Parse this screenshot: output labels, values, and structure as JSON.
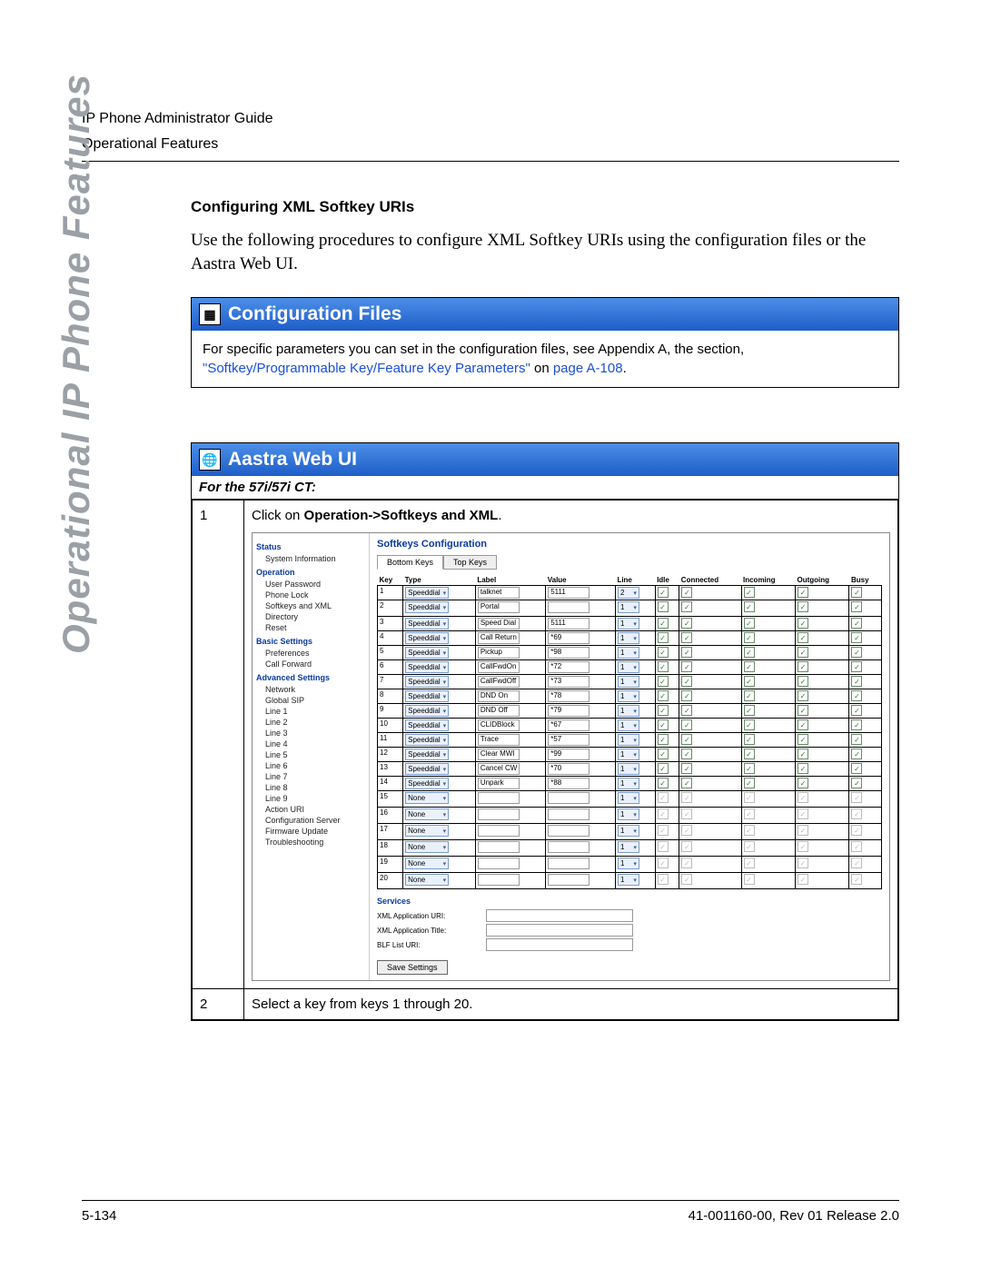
{
  "header": {
    "line1": "IP Phone Administrator Guide",
    "line2": "Operational Features"
  },
  "sideText": "Operational IP Phone Features",
  "section": {
    "title": "Configuring XML Softkey URIs",
    "para": "Use the following procedures to configure XML Softkey URIs using the configuration files or the Aastra Web UI."
  },
  "configFiles": {
    "heading": "Configuration Files",
    "text1": "For specific parameters you can set in the configuration files, see Appendix A, the section, ",
    "link": "\"Softkey/Programmable Key/Feature Key Parameters\"",
    "text2": " on ",
    "pageLink": "page A-108",
    "text3": "."
  },
  "webUI": {
    "heading": "Aastra Web UI",
    "subhead": "For the 57i/57i CT:",
    "steps": [
      {
        "n": "1",
        "textA": "Click on ",
        "bold": "Operation->Softkeys and XML",
        "textB": "."
      },
      {
        "n": "2",
        "textA": "Select a key from keys 1 through 20.",
        "bold": "",
        "textB": ""
      }
    ]
  },
  "screenshot": {
    "nav": {
      "groups": [
        {
          "title": "Status",
          "items": [
            "System Information"
          ]
        },
        {
          "title": "Operation",
          "items": [
            "User Password",
            "Phone Lock",
            "Softkeys and XML",
            "Directory",
            "Reset"
          ]
        },
        {
          "title": "Basic Settings",
          "items": [
            "Preferences",
            "Call Forward"
          ]
        },
        {
          "title": "Advanced Settings",
          "items": [
            "Network",
            "Global SIP",
            "Line 1",
            "Line 2",
            "Line 3",
            "Line 4",
            "Line 5",
            "Line 6",
            "Line 7",
            "Line 8",
            "Line 9",
            "Action URI",
            "Configuration Server",
            "Firmware Update",
            "Troubleshooting"
          ]
        }
      ]
    },
    "title": "Softkeys Configuration",
    "tabs": [
      "Bottom Keys",
      "Top Keys"
    ],
    "cols": [
      "Key",
      "Type",
      "Label",
      "Value",
      "Line",
      "Idle",
      "Connected",
      "Incoming",
      "Outgoing",
      "Busy"
    ],
    "rows": [
      {
        "k": "1",
        "type": "Speeddial",
        "label": "talknet",
        "value": "5111",
        "line": "2",
        "en": true
      },
      {
        "k": "2",
        "type": "Speeddial",
        "label": "Portal",
        "value": "",
        "line": "1",
        "en": true
      },
      {
        "k": "3",
        "type": "Speeddial",
        "label": "Speed Dial",
        "value": "5111",
        "line": "1",
        "en": true
      },
      {
        "k": "4",
        "type": "Speeddial",
        "label": "Call Return",
        "value": "*69",
        "line": "1",
        "en": true
      },
      {
        "k": "5",
        "type": "Speeddial",
        "label": "Pickup",
        "value": "*98",
        "line": "1",
        "en": true
      },
      {
        "k": "6",
        "type": "Speeddial",
        "label": "CallFwdOn",
        "value": "*72",
        "line": "1",
        "en": true
      },
      {
        "k": "7",
        "type": "Speeddial",
        "label": "CallFwdOff",
        "value": "*73",
        "line": "1",
        "en": true
      },
      {
        "k": "8",
        "type": "Speeddial",
        "label": "DND On",
        "value": "*78",
        "line": "1",
        "en": true
      },
      {
        "k": "9",
        "type": "Speeddial",
        "label": "DND Off",
        "value": "*79",
        "line": "1",
        "en": true
      },
      {
        "k": "10",
        "type": "Speeddial",
        "label": "CLIDBlock",
        "value": "*67",
        "line": "1",
        "en": true
      },
      {
        "k": "11",
        "type": "Speeddial",
        "label": "Trace",
        "value": "*57",
        "line": "1",
        "en": true
      },
      {
        "k": "12",
        "type": "Speeddial",
        "label": "Clear MWI",
        "value": "*99",
        "line": "1",
        "en": true
      },
      {
        "k": "13",
        "type": "Speeddial",
        "label": "Cancel CW",
        "value": "*70",
        "line": "1",
        "en": true
      },
      {
        "k": "14",
        "type": "Speeddial",
        "label": "Unpark",
        "value": "*88",
        "line": "1",
        "en": true
      },
      {
        "k": "15",
        "type": "None",
        "label": "",
        "value": "",
        "line": "1",
        "en": false
      },
      {
        "k": "16",
        "type": "None",
        "label": "",
        "value": "",
        "line": "1",
        "en": false
      },
      {
        "k": "17",
        "type": "None",
        "label": "",
        "value": "",
        "line": "1",
        "en": false
      },
      {
        "k": "18",
        "type": "None",
        "label": "",
        "value": "",
        "line": "1",
        "en": false
      },
      {
        "k": "19",
        "type": "None",
        "label": "",
        "value": "",
        "line": "1",
        "en": false
      },
      {
        "k": "20",
        "type": "None",
        "label": "",
        "value": "",
        "line": "1",
        "en": false
      }
    ],
    "services": {
      "heading": "Services",
      "fields": [
        "XML Application URI:",
        "XML Application Title:",
        "BLF List URI:"
      ]
    },
    "saveBtn": "Save Settings"
  },
  "footer": {
    "left": "5-134",
    "right": "41-001160-00, Rev 01  Release 2.0"
  }
}
